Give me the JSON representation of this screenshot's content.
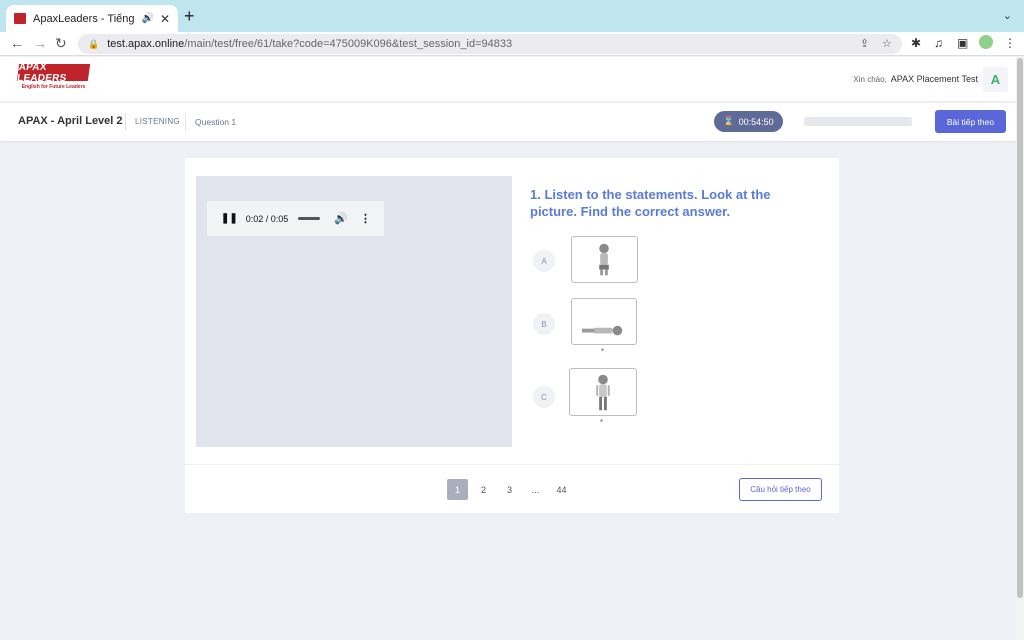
{
  "browser": {
    "tab_title": "ApaxLeaders - Tiếng Anh t",
    "audio_indicator": "🔊",
    "close_glyph": "✕",
    "new_tab_glyph": "+",
    "tab_menu_glyph": "⌄",
    "back_glyph": "←",
    "forward_glyph": "→",
    "reload_glyph": "↻",
    "lock_glyph": "🔒",
    "url_host": "test.apax.online",
    "url_path": "/main/test/free/61/take?code=475009K096&test_session_id=94833",
    "share_glyph": "⇪",
    "star_glyph": "☆",
    "puzzle_glyph": "✱",
    "media_glyph": "♫",
    "sidepanel_glyph": "▣",
    "menu_glyph": "⋮"
  },
  "header": {
    "logo_text": "APAX LEADERS",
    "logo_tagline": "English for Future Leaders",
    "greeting": "Xin chào,",
    "user_name": "APAX Placement Test",
    "avatar_letter": "A",
    "brand_color": "#c0242b"
  },
  "subheader": {
    "course_title": "APAX - April Level 2",
    "section": "LISTENING",
    "question_label": "Question 1",
    "timer_icon": "⌛",
    "timer": "00:54:50",
    "progress": 0,
    "next_section_label": "Bài tiếp theo",
    "accent_color": "#5a67d8"
  },
  "audio_player": {
    "play_state_glyph": "❚❚",
    "time": "0:02 / 0:05",
    "progress_fraction": 0.4,
    "volume_glyph": "🔊",
    "more_glyph": "⋮"
  },
  "question": {
    "text": "1. Listen to the statements. Look at the picture. Find the correct answer.",
    "options": [
      {
        "letter": "A",
        "image": "boy-standing-hands-clasped"
      },
      {
        "letter": "B",
        "image": "boy-lying-down"
      },
      {
        "letter": "C",
        "image": "boy-standing-arms-down"
      }
    ]
  },
  "pagination": {
    "pages": [
      "1",
      "2",
      "3",
      "...",
      "44"
    ],
    "active": "1",
    "next_question_label": "Câu hỏi tiếp theo"
  }
}
